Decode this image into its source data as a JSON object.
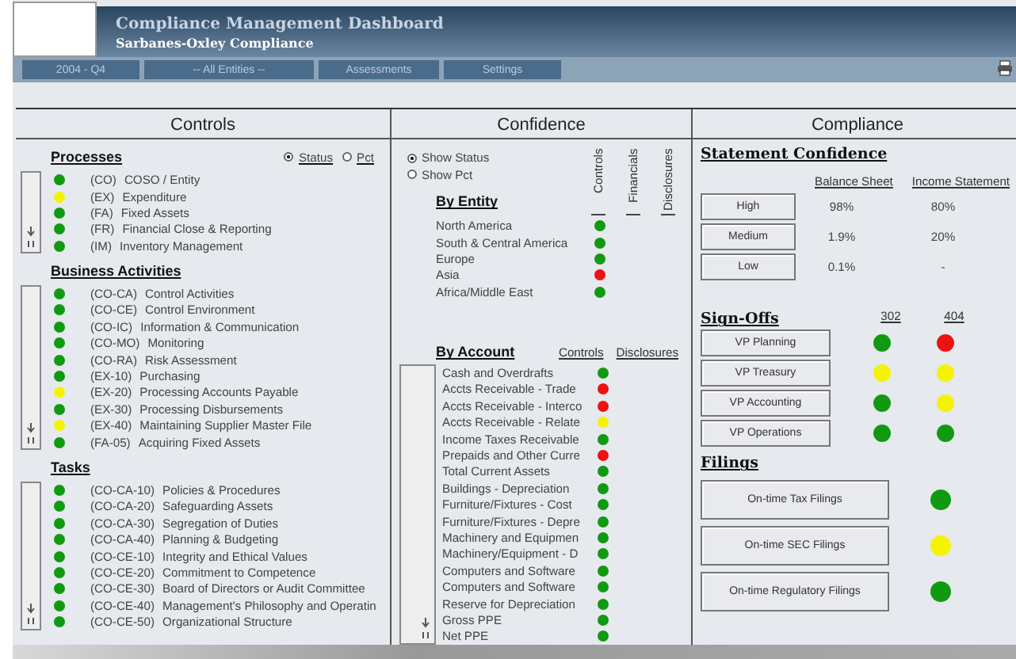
{
  "header": {
    "title": "Compliance Management Dashboard",
    "subtitle": "Sarbanes-Oxley Compliance"
  },
  "nav": [
    "2004 - Q4",
    "-- All Entities --",
    "Assessments",
    "Settings"
  ],
  "controls": {
    "title": "Controls",
    "view_options": [
      {
        "label": "Status",
        "selected": true
      },
      {
        "label": "Pct",
        "selected": false
      }
    ],
    "sections": [
      {
        "title": "Processes",
        "items": [
          {
            "code": "(CO)",
            "name": "COSO / Entity",
            "color": "#119a11"
          },
          {
            "code": "(EX)",
            "name": "Expenditure",
            "color": "#f4f400"
          },
          {
            "code": "(FA)",
            "name": "Fixed Assets",
            "color": "#119a11"
          },
          {
            "code": "(FR)",
            "name": "Financial Close & Reporting",
            "color": "#119a11"
          },
          {
            "code": "(IM)",
            "name": "Inventory Management",
            "color": "#119a11"
          }
        ]
      },
      {
        "title": "Business Activities",
        "items": [
          {
            "code": "(CO-CA)",
            "name": "Control Activities",
            "color": "#119a11"
          },
          {
            "code": "(CO-CE)",
            "name": "Control Environment",
            "color": "#119a11"
          },
          {
            "code": "(CO-IC)",
            "name": "Information & Communication",
            "color": "#119a11"
          },
          {
            "code": "(CO-MO)",
            "name": "Monitoring",
            "color": "#119a11"
          },
          {
            "code": "(CO-RA)",
            "name": "Risk Assessment",
            "color": "#119a11"
          },
          {
            "code": "(EX-10)",
            "name": "Purchasing",
            "color": "#119a11"
          },
          {
            "code": "(EX-20)",
            "name": "Processing Accounts Payable",
            "color": "#f4f400"
          },
          {
            "code": "(EX-30)",
            "name": "Processing Disbursements",
            "color": "#119a11"
          },
          {
            "code": "(EX-40)",
            "name": "Maintaining Supplier Master File",
            "color": "#f4f400"
          },
          {
            "code": "(FA-05)",
            "name": "Acquiring Fixed Assets",
            "color": "#119a11"
          }
        ]
      },
      {
        "title": "Tasks",
        "items": [
          {
            "code": "(CO-CA-10)",
            "name": "Policies & Procedures",
            "color": "#119a11"
          },
          {
            "code": "(CO-CA-20)",
            "name": "Safeguarding Assets",
            "color": "#119a11"
          },
          {
            "code": "(CO-CA-30)",
            "name": "Segregation of Duties",
            "color": "#119a11"
          },
          {
            "code": "(CO-CA-40)",
            "name": "Planning & Budgeting",
            "color": "#119a11"
          },
          {
            "code": "(CO-CE-10)",
            "name": "Integrity and Ethical Values",
            "color": "#119a11"
          },
          {
            "code": "(CO-CE-20)",
            "name": "Commitment to Competence",
            "color": "#119a11"
          },
          {
            "code": "(CO-CE-30)",
            "name": "Board of Directors or Audit Committee",
            "color": "#119a11"
          },
          {
            "code": "(CO-CE-40)",
            "name": "Management's Philosophy and Operatin",
            "color": "#119a11"
          },
          {
            "code": "(CO-CE-50)",
            "name": "Organizational Structure",
            "color": "#119a11"
          }
        ]
      }
    ]
  },
  "confidence": {
    "title": "Confidence",
    "view_options": [
      {
        "label": "Show Status",
        "selected": true
      },
      {
        "label": "Show Pct",
        "selected": false
      }
    ],
    "entity_columns": [
      "Controls",
      "Financials",
      "Disclosures"
    ],
    "by_entity": {
      "title": "By Entity",
      "rows": [
        {
          "name": "North America",
          "color": "#119a11"
        },
        {
          "name": "South & Central America",
          "color": "#119a11"
        },
        {
          "name": "Europe",
          "color": "#119a11"
        },
        {
          "name": "Asia",
          "color": "#ee1111"
        },
        {
          "name": "Africa/Middle East",
          "color": "#119a11"
        }
      ]
    },
    "by_account": {
      "title": "By Account",
      "columns": [
        "Controls",
        "Disclosures"
      ],
      "rows": [
        {
          "name": "Cash and Overdrafts",
          "color": "#119a11"
        },
        {
          "name": "Accts Receivable - Trade",
          "color": "#ee1111"
        },
        {
          "name": "Accts Receivable - Interco",
          "color": "#ee1111"
        },
        {
          "name": "Accts Receivable - Relate",
          "color": "#f4f400"
        },
        {
          "name": "Income Taxes Receivable",
          "color": "#119a11"
        },
        {
          "name": "Prepaids and Other Curre",
          "color": "#ee1111"
        },
        {
          "name": "Total Current Assets",
          "color": "#119a11"
        },
        {
          "name": "Buildings - Depreciation",
          "color": "#119a11"
        },
        {
          "name": "Furniture/Fixtures - Cost",
          "color": "#119a11"
        },
        {
          "name": "Furniture/Fixtures - Depre",
          "color": "#119a11"
        },
        {
          "name": "Machinery and Equipmen",
          "color": "#119a11"
        },
        {
          "name": "Machinery/Equipment - D",
          "color": "#119a11"
        },
        {
          "name": "Computers and Software",
          "color": "#119a11"
        },
        {
          "name": "Computers and Software",
          "color": "#119a11"
        },
        {
          "name": "Reserve for Depreciation",
          "color": "#119a11"
        },
        {
          "name": "Gross PPE",
          "color": "#119a11"
        },
        {
          "name": "Net PPE",
          "color": "#119a11"
        }
      ]
    }
  },
  "compliance": {
    "title": "Compliance",
    "statement_confidence": {
      "title": "Statement Confidence",
      "columns": [
        "Balance Sheet",
        "Income Statement"
      ],
      "rows": [
        {
          "label": "High",
          "values": [
            "98%",
            "80%"
          ]
        },
        {
          "label": "Medium",
          "values": [
            "1.9%",
            "20%"
          ]
        },
        {
          "label": "Low",
          "values": [
            "0.1%",
            "-"
          ]
        }
      ]
    },
    "sign_offs": {
      "title": "Sign-Offs",
      "columns": [
        "302",
        "404"
      ],
      "rows": [
        {
          "label": "VP Planning",
          "statuses": [
            {
              "color": "#119a11"
            },
            {
              "color": "#ee1111"
            }
          ]
        },
        {
          "label": "VP Treasury",
          "statuses": [
            {
              "color": "#f4f400"
            },
            {
              "color": "#f4f400"
            }
          ]
        },
        {
          "label": "VP Accounting",
          "statuses": [
            {
              "color": "#119a11"
            },
            {
              "color": "#f4f400"
            }
          ]
        },
        {
          "label": "VP Operations",
          "statuses": [
            {
              "color": "#119a11"
            },
            {
              "color": "#119a11"
            }
          ]
        }
      ]
    },
    "filings": {
      "title": "Filings",
      "rows": [
        {
          "label": "On-time Tax Filings",
          "color": "#119a11"
        },
        {
          "label": "On-time SEC Filings",
          "color": "#f4f400"
        },
        {
          "label": "On-time Regulatory Filings",
          "color": "#119a11"
        }
      ]
    }
  }
}
